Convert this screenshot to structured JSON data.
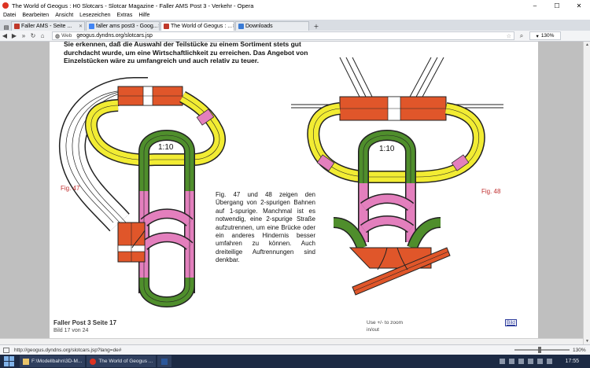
{
  "window": {
    "title": "The World of Geogus : H0 Slotcars - Slotcar Magazine - Faller AMS Post 3 - Verkehr - Opera",
    "controls": {
      "minimize": "–",
      "maximize": "☐",
      "close": "✕"
    }
  },
  "menu": [
    "Datei",
    "Bearbeiten",
    "Ansicht",
    "Lesezeichen",
    "Extras",
    "Hilfe"
  ],
  "tabs": [
    {
      "label": "Faller AMS - Seite ...",
      "active": false
    },
    {
      "label": "faller ams post3 - Goog...",
      "active": false
    },
    {
      "label": "The World of Geogus : ...",
      "active": true
    },
    {
      "label": "Downloads",
      "active": false
    }
  ],
  "address": {
    "label": "Web",
    "url": "geogus.dyndns.org/slotcars.jsp",
    "zoom": "130%"
  },
  "page": {
    "body_text": "Sie erkennen, daß die Auswahl der Teilstücke zu einem Sortiment stets gut durchdacht wurde, um eine Wirtschaftlichkeit zu erreichen. Das Angebot von Einzelstücken wäre zu umfangreich und auch relativ zu teuer.",
    "caption": "Fig. 47 und 48 zeigen den Übergang von 2-spurigen Bahnen auf 1-spurige. Manchmal ist es notwendig, eine 2-spurige Straße aufzutrennen, um eine Brücke oder ein anderes Hindernis besser umfahren zu können. Auch dreiteilige Auftrennungen sind denkbar.",
    "fig47_label": "Fig. 47",
    "fig48_label": "Fig. 48",
    "scale_label_1": "1:10",
    "scale_label_2": "1:10",
    "footer_title": "Faller Post 3 Seite 17",
    "footer_page": "Bild 17 von 24",
    "zoom_hint": "Use +/- to zoom in/out",
    "bild_link": "Bild"
  },
  "status": {
    "url": "http://geogus.dyndns.org/slotcars.jsp?lang=de#"
  },
  "taskbar": {
    "items": [
      {
        "label": "F:\\Modellbahn\\3D-M..."
      },
      {
        "label": "The World of Geogus ..."
      },
      {
        "label": ""
      }
    ],
    "clock": "17:55"
  },
  "colors": {
    "track_red": "#e0562a",
    "track_yellow": "#f2ec33",
    "track_green": "#4f8e2c",
    "track_pink": "#e37fbd",
    "track_white": "#ffffff",
    "track_lines": "#222222",
    "fig_label": "#c03030"
  }
}
